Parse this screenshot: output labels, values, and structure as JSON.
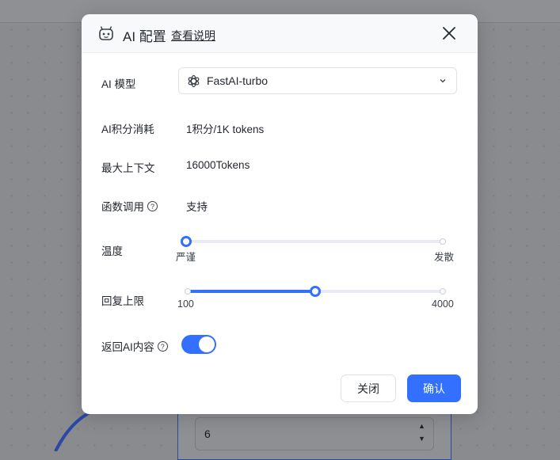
{
  "background": {
    "number_value": "6"
  },
  "dialog": {
    "title": "AI 配置",
    "help_link": "查看说明",
    "fields": {
      "model": {
        "label": "AI 模型",
        "value": "FastAI-turbo"
      },
      "cost": {
        "label": "AI积分消耗",
        "value": "1积分/1K tokens"
      },
      "context": {
        "label": "最大上下文",
        "value": "16000Tokens"
      },
      "functions": {
        "label": "函数调用",
        "value": "支持"
      },
      "temperature": {
        "label": "温度",
        "min_label": "严谨",
        "max_label": "发散",
        "level": 0
      },
      "max_reply": {
        "label": "回复上限",
        "min_label": "100",
        "max_label": "4000",
        "level": 0.5
      },
      "return_ai": {
        "label": "返回AI内容",
        "enabled": true
      }
    },
    "buttons": {
      "close": "关闭",
      "confirm": "确认"
    }
  },
  "colors": {
    "accent": "#3370ff",
    "overlay": "#8a8b8e",
    "node_border": "#2b48a8"
  }
}
